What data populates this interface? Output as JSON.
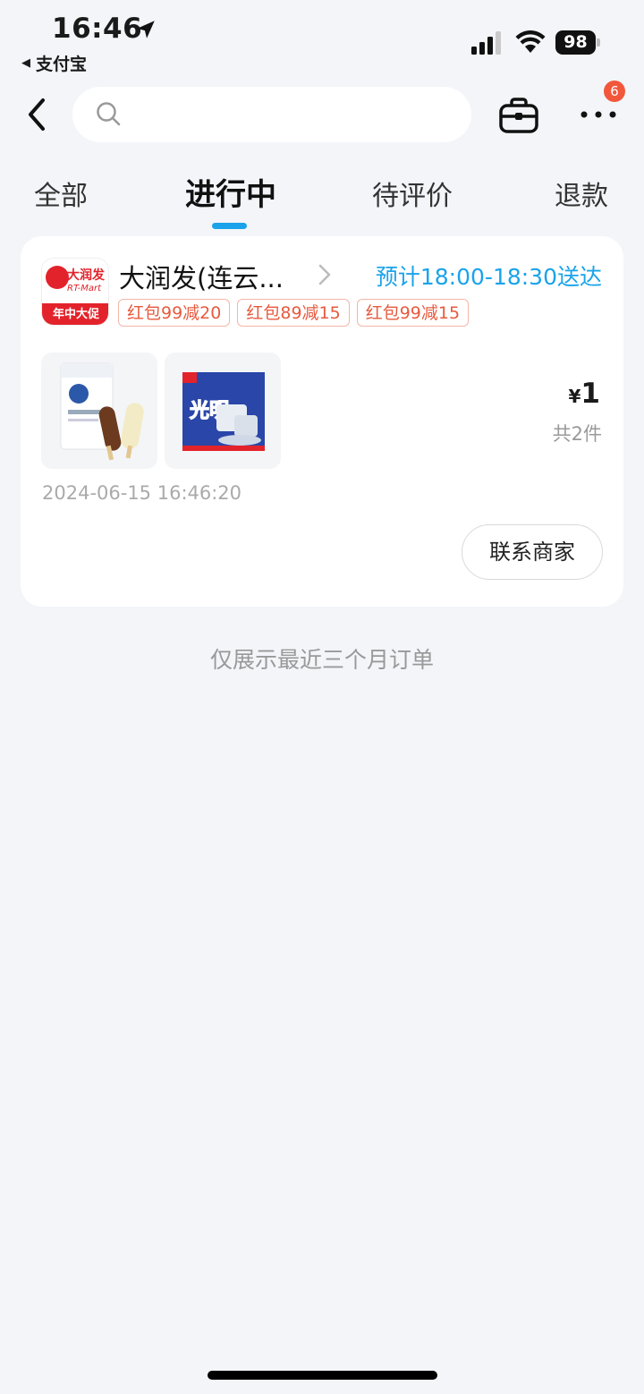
{
  "status_bar": {
    "time": "16:46",
    "back_app": "支付宝",
    "battery": "98"
  },
  "nav": {
    "search_placeholder": "",
    "more_badge": "6"
  },
  "tabs": [
    {
      "label": "全部",
      "active": false
    },
    {
      "label": "进行中",
      "active": true
    },
    {
      "label": "待评价",
      "active": false
    },
    {
      "label": "退款",
      "active": false
    }
  ],
  "order": {
    "store_logo": {
      "brand": "大润发",
      "brand_en": "RT-Mart",
      "banner": "年中大促"
    },
    "store_name": "大润发(连云...",
    "eta": "预计18:00-18:30送达",
    "coupons": [
      "红包99减20",
      "红包89减15",
      "红包99减15"
    ],
    "products": [
      {
        "icon": "ice-cream-bar-product-image"
      },
      {
        "icon": "guangming-ice-product-image",
        "brand": "光明"
      }
    ],
    "price_currency": "¥",
    "price_amount": "1",
    "item_count": "共2件",
    "order_time": "2024-06-15 16:46:20",
    "contact_label": "联系商家"
  },
  "footer_note": "仅展示最近三个月订单",
  "colors": {
    "accent": "#1aa3ea",
    "coupon": "#e65a3e",
    "brand_red": "#e3232b",
    "background": "#f3f5f9"
  }
}
